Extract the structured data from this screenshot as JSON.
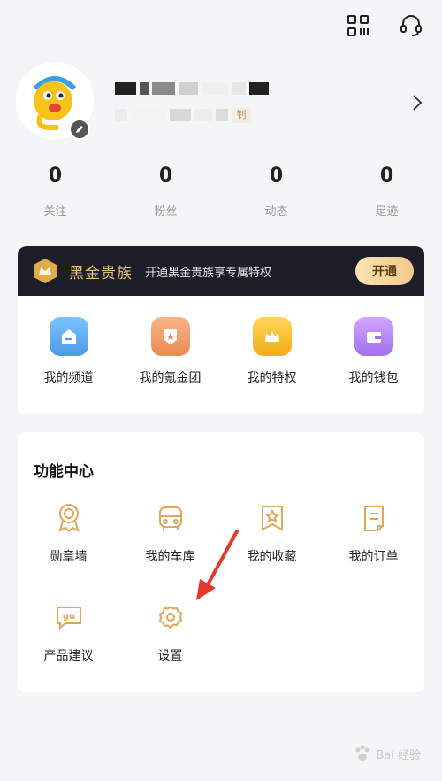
{
  "stats": [
    {
      "value": "0",
      "label": "关注"
    },
    {
      "value": "0",
      "label": "粉丝"
    },
    {
      "value": "0",
      "label": "动态"
    },
    {
      "value": "0",
      "label": "足迹"
    }
  ],
  "vip": {
    "title": "黑金贵族",
    "description": "开通黑金贵族享专属特权",
    "button_label": "开通",
    "items": [
      {
        "label": "我的频道",
        "icon": "channel-icon",
        "color": "#5aa9f0"
      },
      {
        "label": "我的氪金团",
        "icon": "team-icon",
        "color": "#f29b6b"
      },
      {
        "label": "我的特权",
        "icon": "crown-icon",
        "color": "#f6b92b"
      },
      {
        "label": "我的钱包",
        "icon": "wallet-icon",
        "color": "#b07cf0"
      }
    ]
  },
  "functions": {
    "title": "功能中心",
    "items": [
      {
        "label": "勋章墙",
        "icon": "medal-icon"
      },
      {
        "label": "我的车库",
        "icon": "car-icon"
      },
      {
        "label": "我的收藏",
        "icon": "favorites-icon"
      },
      {
        "label": "我的订单",
        "icon": "order-icon"
      },
      {
        "label": "产品建议",
        "icon": "feedback-icon",
        "icon_text": "gu"
      },
      {
        "label": "设置",
        "icon": "settings-icon"
      }
    ]
  },
  "name_fragment": "钊",
  "watermark": {
    "text": "Bai 经验"
  },
  "colors": {
    "accent_gold": "#e8c07a",
    "vip_bar": "#1d1e28",
    "function_icon": "#e0a45a",
    "annotation_arrow": "#e5382b"
  }
}
